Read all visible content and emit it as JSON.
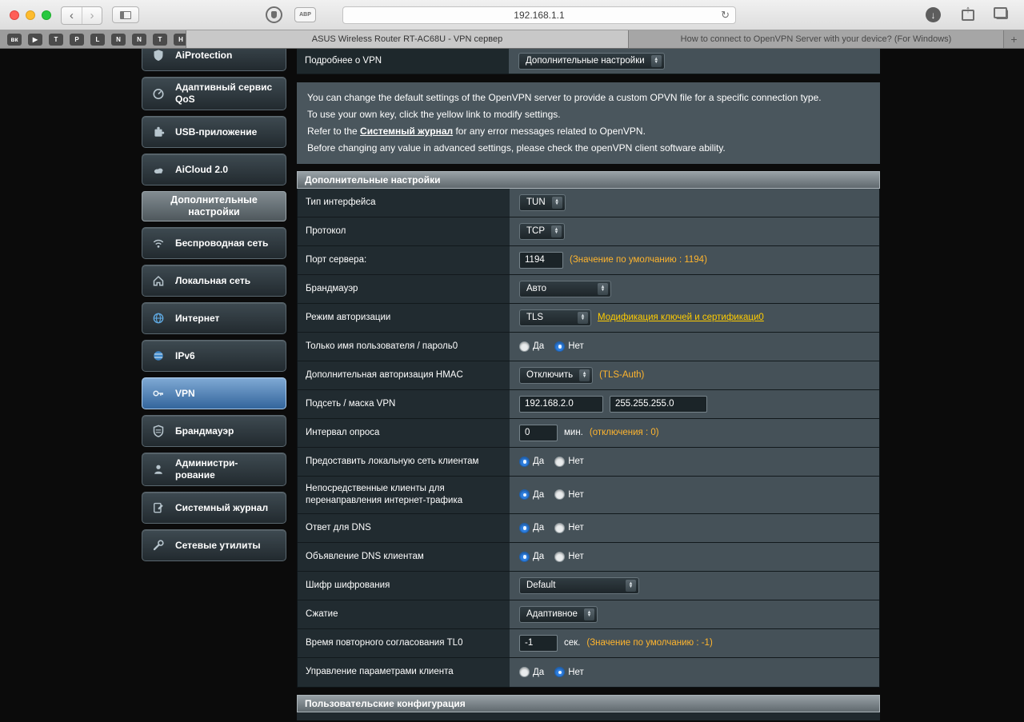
{
  "browser": {
    "url": "192.168.1.1",
    "abp_label": "ABP",
    "bookmarks": [
      {
        "glyph": "вк"
      },
      {
        "glyph": "▶"
      },
      {
        "glyph": "T"
      },
      {
        "glyph": "P"
      },
      {
        "glyph": "L"
      },
      {
        "glyph": "N"
      },
      {
        "glyph": "N"
      },
      {
        "glyph": "T"
      },
      {
        "glyph": "H"
      }
    ],
    "tabs": {
      "active": "ASUS Wireless Router RT-AC68U - VPN сервер",
      "inactive": "How to connect to OpenVPN Server with your device? (For Windows)",
      "new_tab": "+"
    }
  },
  "sidebar": {
    "items_top": [
      {
        "label": "AiProtection"
      },
      {
        "label": "Адаптивный сервис QoS"
      },
      {
        "label": "USB-приложение"
      },
      {
        "label": "AiCloud 2.0"
      }
    ],
    "section_title": "Дополнительные настройки",
    "items": [
      {
        "label": "Беспроводная сеть"
      },
      {
        "label": "Локальная сеть"
      },
      {
        "label": "Интернет"
      },
      {
        "label": "IPv6"
      },
      {
        "label": "VPN"
      },
      {
        "label": "Брандмауэр"
      },
      {
        "label": "Администри-рование"
      },
      {
        "label": "Системный журнал"
      },
      {
        "label": "Сетевые утилиты"
      }
    ]
  },
  "main": {
    "top_row": {
      "label": "Подробнее о VPN",
      "value": "Дополнительные настройки"
    },
    "desc": {
      "line1": "You can change the default settings of the OpenVPN server to provide a custom OPVN file for a specific connection type.",
      "line2": "To use your own key, click the yellow link to modify settings.",
      "line3_pre": "Refer to the ",
      "line3_link": "Системный журнал",
      "line3_post": " for any error messages related to OpenVPN.",
      "line4": "Before changing any value in advanced settings, please check the openVPN client software ability."
    },
    "section_title": "Дополнительные настройки",
    "bottom_section_title": "Пользовательские конфигурация",
    "radio_yes": "Да",
    "radio_no": "Нет",
    "rows": [
      {
        "label": "Тип интерфейса",
        "value": "TUN"
      },
      {
        "label": "Протокол",
        "value": "TCP"
      },
      {
        "label": "Порт сервера:",
        "value": "1194",
        "note": "(Значение по умолчанию : 1194)"
      },
      {
        "label": "Брандмауэр",
        "value": "Авто"
      },
      {
        "label": "Режим авторизации",
        "value": "TLS",
        "link": "Модификация ключей и сертификаци0"
      },
      {
        "label": "Только имя пользователя / пароль0",
        "value": "Нет"
      },
      {
        "label": "Дополнительная авторизация HMAC",
        "value": "Отключить",
        "note": "(TLS-Auth)"
      },
      {
        "label": "Подсеть / маска VPN",
        "value": "192.168.2.0",
        "value2": "255.255.255.0"
      },
      {
        "label": "Интервал опроса",
        "value": "0",
        "unit": "мин.",
        "note": "(отключения : 0)"
      },
      {
        "label": "Предоставить локальную сеть клиентам",
        "value": "Да"
      },
      {
        "label": "Непосредственные клиенты для перенаправления интернет-трафика",
        "value": "Да"
      },
      {
        "label": "Ответ для DNS",
        "value": "Да"
      },
      {
        "label": "Объявление DNS клиентам",
        "value": "Да"
      },
      {
        "label": "Шифр шифрования",
        "value": "Default"
      },
      {
        "label": "Сжатие",
        "value": "Адаптивное"
      },
      {
        "label": "Время повторного согласования TL0",
        "value": "-1",
        "unit": "сек.",
        "note": "(Значение по умолчанию : -1)"
      },
      {
        "label": "Управление параметрами клиента",
        "value": "Нет"
      }
    ]
  }
}
